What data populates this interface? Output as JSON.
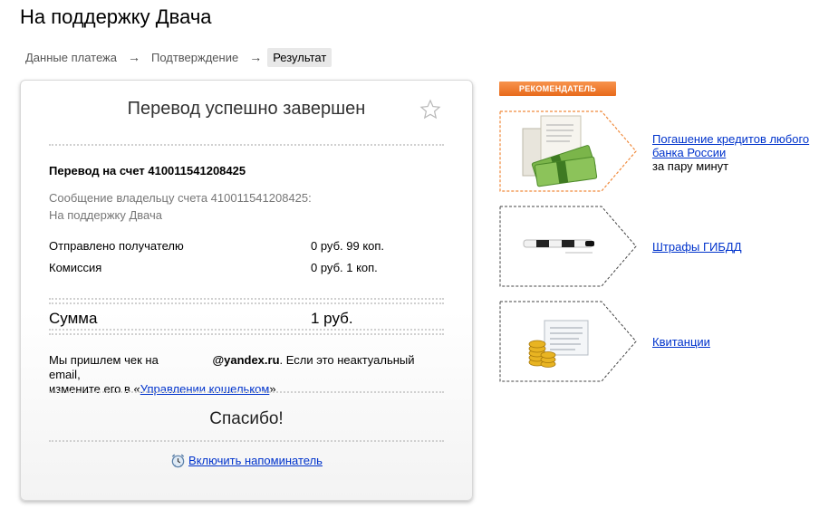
{
  "page": {
    "title": "На поддержку Двача"
  },
  "steps": [
    {
      "label": "Данные платежа"
    },
    {
      "label": "Подтверждение"
    },
    {
      "label": "Результат"
    }
  ],
  "card": {
    "title": "Перевод успешно завершен",
    "transfer_to": "Перевод на счет 410011541208425",
    "message_label": "Сообщение владельцу счета 410011541208425:",
    "message_text": "На поддержку Двача",
    "rows": [
      {
        "label": "Отправлено получателю",
        "value": "0 руб. 99 коп."
      },
      {
        "label": "Комиссия",
        "value": "0 руб. 1 коп."
      }
    ],
    "total": {
      "label": "Сумма",
      "value": "1 руб."
    },
    "receipt": {
      "pre": "Мы пришлем чек на ",
      "email": "@yandex.ru",
      "mid": ". Если это неактуальный email,",
      "line2_pre": "измените его в «",
      "link": "Управлении кошельком",
      "line2_post": "»."
    },
    "thanks": "Спасибо!",
    "reminder": "Включить напоминатель"
  },
  "recommender": {
    "badge": "РЕКОМЕНДАТЕЛЬ",
    "accent": "#e86a1b",
    "items": [
      {
        "title": "Погашение кредитов любого банка России",
        "subtitle": "за пару минут",
        "icon": "money-icon",
        "active": true
      },
      {
        "title": "Штрафы ГИБДД",
        "subtitle": "",
        "icon": "police-baton-icon",
        "active": false
      },
      {
        "title": "Квитанции",
        "subtitle": "",
        "icon": "coins-receipt-icon",
        "active": false
      }
    ]
  }
}
